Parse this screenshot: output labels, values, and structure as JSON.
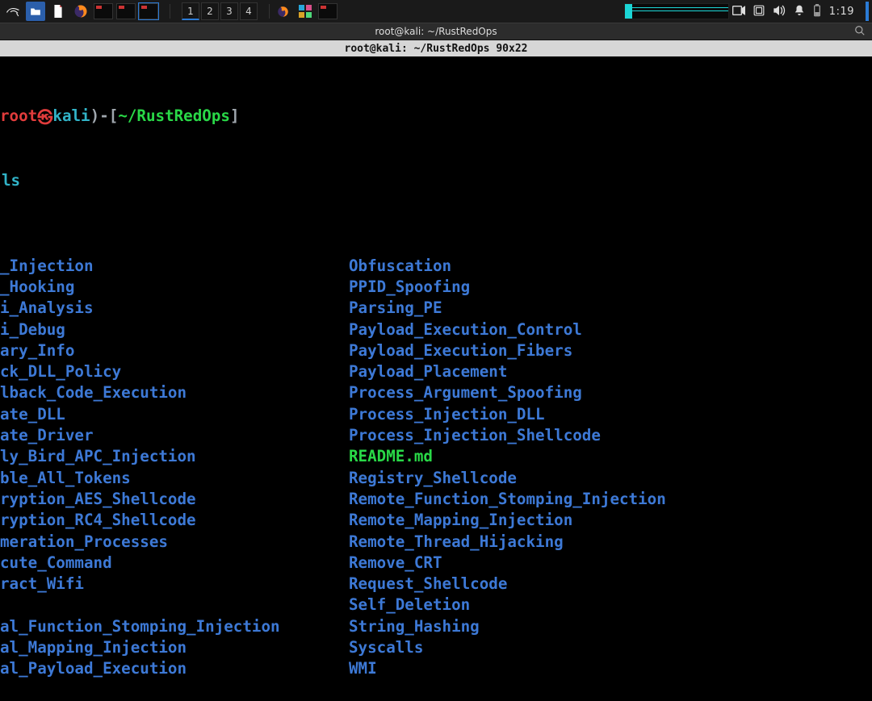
{
  "taskbar": {
    "workspaces": [
      "1",
      "2",
      "3",
      "4"
    ],
    "active_workspace": 0,
    "clock": "1:19"
  },
  "window": {
    "title": "root@kali: ~/RustRedOps",
    "term_info": "root@kali: ~/RustRedOps 90x22"
  },
  "prompt": {
    "user": "root",
    "sep1": "㉿",
    "host": "kali",
    "close_paren": ")",
    "dash": "-",
    "lbrack": "[",
    "path": "~/RustRedOps",
    "rbrack": "]"
  },
  "command": "ls",
  "ls": {
    "col1": [
      "_Injection",
      "_Hooking",
      "i_Analysis",
      "i_Debug",
      "ary_Info",
      "ck_DLL_Policy",
      "lback_Code_Execution",
      "ate_DLL",
      "ate_Driver",
      "ly_Bird_APC_Injection",
      "ble_All_Tokens",
      "ryption_AES_Shellcode",
      "ryption_RC4_Shellcode",
      "meration_Processes",
      "cute_Command",
      "ract_Wifi",
      "",
      "al_Function_Stomping_Injection",
      "al_Mapping_Injection",
      "al_Payload_Execution"
    ],
    "col2": [
      {
        "t": "Obfuscation",
        "c": "blue"
      },
      {
        "t": "PPID_Spoofing",
        "c": "blue"
      },
      {
        "t": "Parsing_PE",
        "c": "blue"
      },
      {
        "t": "Payload_Execution_Control",
        "c": "blue"
      },
      {
        "t": "Payload_Execution_Fibers",
        "c": "blue"
      },
      {
        "t": "Payload_Placement",
        "c": "blue"
      },
      {
        "t": "Process_Argument_Spoofing",
        "c": "blue"
      },
      {
        "t": "Process_Injection_DLL",
        "c": "blue"
      },
      {
        "t": "Process_Injection_Shellcode",
        "c": "blue"
      },
      {
        "t": "README.md",
        "c": "green"
      },
      {
        "t": "Registry_Shellcode",
        "c": "blue"
      },
      {
        "t": "Remote_Function_Stomping_Injection",
        "c": "blue"
      },
      {
        "t": "Remote_Mapping_Injection",
        "c": "blue"
      },
      {
        "t": "Remote_Thread_Hijacking",
        "c": "blue"
      },
      {
        "t": "Remove_CRT",
        "c": "blue"
      },
      {
        "t": "Request_Shellcode",
        "c": "blue"
      },
      {
        "t": "Self_Deletion",
        "c": "blue"
      },
      {
        "t": "String_Hashing",
        "c": "blue"
      },
      {
        "t": "Syscalls",
        "c": "blue"
      },
      {
        "t": "WMI",
        "c": "blue"
      }
    ]
  }
}
